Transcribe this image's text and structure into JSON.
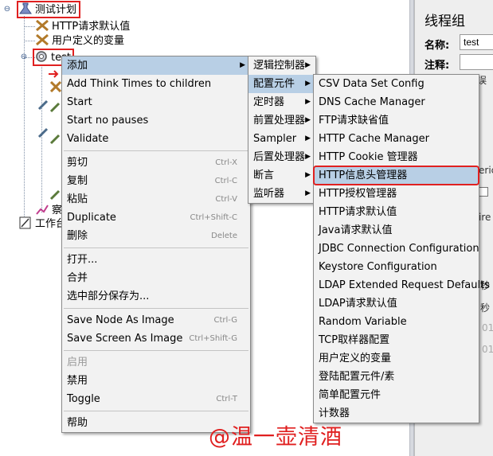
{
  "tree": {
    "root": "测试计划",
    "children": [
      "HTTP请求默认值",
      "用户定义的变量",
      "test"
    ],
    "partial_node": "察",
    "workbench": "工作台"
  },
  "right_panel": {
    "title": "线程组",
    "name_label": "名称:",
    "name_value": "test",
    "comment_label": "注释:",
    "fragments": [
      "误",
      "eric",
      "ire",
      "秒",
      "秒",
      "01",
      "01"
    ]
  },
  "context_menu": {
    "items": [
      {
        "label": "添加",
        "submenu": true,
        "highlight": true
      },
      {
        "label": "Add Think Times to children"
      },
      {
        "label": "Start"
      },
      {
        "label": "Start no pauses"
      },
      {
        "label": "Validate"
      },
      {
        "sep": true
      },
      {
        "label": "剪切",
        "shortcut": "Ctrl-X"
      },
      {
        "label": "复制",
        "shortcut": "Ctrl-C"
      },
      {
        "label": "粘贴",
        "shortcut": "Ctrl-V"
      },
      {
        "label": "Duplicate",
        "shortcut": "Ctrl+Shift-C"
      },
      {
        "label": "删除",
        "shortcut": "Delete"
      },
      {
        "sep": true
      },
      {
        "label": "打开..."
      },
      {
        "label": "合并"
      },
      {
        "label": "选中部分保存为..."
      },
      {
        "sep": true
      },
      {
        "label": "Save Node As Image",
        "shortcut": "Ctrl-G"
      },
      {
        "label": "Save Screen As Image",
        "shortcut": "Ctrl+Shift-G"
      },
      {
        "sep": true
      },
      {
        "label": "启用",
        "disabled": true
      },
      {
        "label": "禁用"
      },
      {
        "label": "Toggle",
        "shortcut": "Ctrl-T"
      },
      {
        "sep": true
      },
      {
        "label": "帮助"
      }
    ]
  },
  "add_submenu": {
    "items": [
      {
        "label": "逻辑控制器"
      },
      {
        "label": "配置元件",
        "highlight": true
      },
      {
        "label": "定时器"
      },
      {
        "label": "前置处理器"
      },
      {
        "label": "Sampler"
      },
      {
        "label": "后置处理器"
      },
      {
        "label": "断言"
      },
      {
        "label": "监听器"
      }
    ]
  },
  "config_submenu": {
    "items": [
      "CSV Data Set Config",
      "DNS Cache Manager",
      "FTP请求缺省值",
      "HTTP Cache Manager",
      "HTTP Cookie 管理器",
      "HTTP信息头管理器",
      "HTTP授权管理器",
      "HTTP请求默认值",
      "Java请求默认值",
      "JDBC Connection Configuration",
      "Keystore Configuration",
      "LDAP Extended Request Defaults",
      "LDAP请求默认值",
      "Random Variable",
      "TCP取样器配置",
      "用户定义的变量",
      "登陆配置元件/素",
      "简单配置元件",
      "计数器"
    ],
    "highlighted_index": 5
  },
  "watermark": "@温一壶清酒",
  "colors": {
    "highlight": "#b8cfe5",
    "annotation": "#e02020",
    "menu_bg": "#f2f2f2"
  }
}
